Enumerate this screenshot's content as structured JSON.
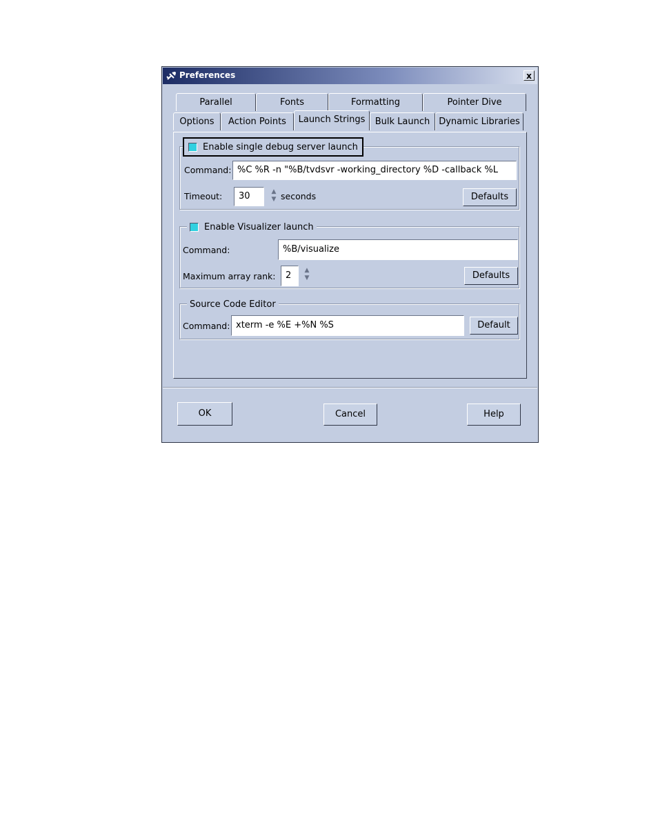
{
  "window": {
    "title": "Preferences",
    "close_label": "x"
  },
  "tabs_back": [
    "Parallel",
    "Fonts",
    "Formatting",
    "Pointer Dive"
  ],
  "tabs_front": [
    "Options",
    "Action Points",
    "Launch Strings",
    "Bulk Launch",
    "Dynamic Libraries"
  ],
  "active_tab": "Launch Strings",
  "debug_server": {
    "label": "Enable single debug server launch",
    "checked": true,
    "command_label": "Command:",
    "command_value": "%C %R -n \"%B/tvdsvr -working_directory %D -callback %L",
    "timeout_label": "Timeout:",
    "timeout_value": "30",
    "seconds_label": "seconds",
    "defaults_label": "Defaults"
  },
  "visualizer": {
    "label": "Enable Visualizer launch",
    "checked": true,
    "command_label": "Command:",
    "command_value": "%B/visualize",
    "rank_label": "Maximum array rank:",
    "rank_value": "2",
    "defaults_label": "Defaults"
  },
  "source_editor": {
    "label": "Source Code Editor",
    "command_label": "Command:",
    "command_value": "xterm -e %E +%N %S",
    "default_label": "Default"
  },
  "footer": {
    "ok": "OK",
    "cancel": "Cancel",
    "help": "Help"
  }
}
